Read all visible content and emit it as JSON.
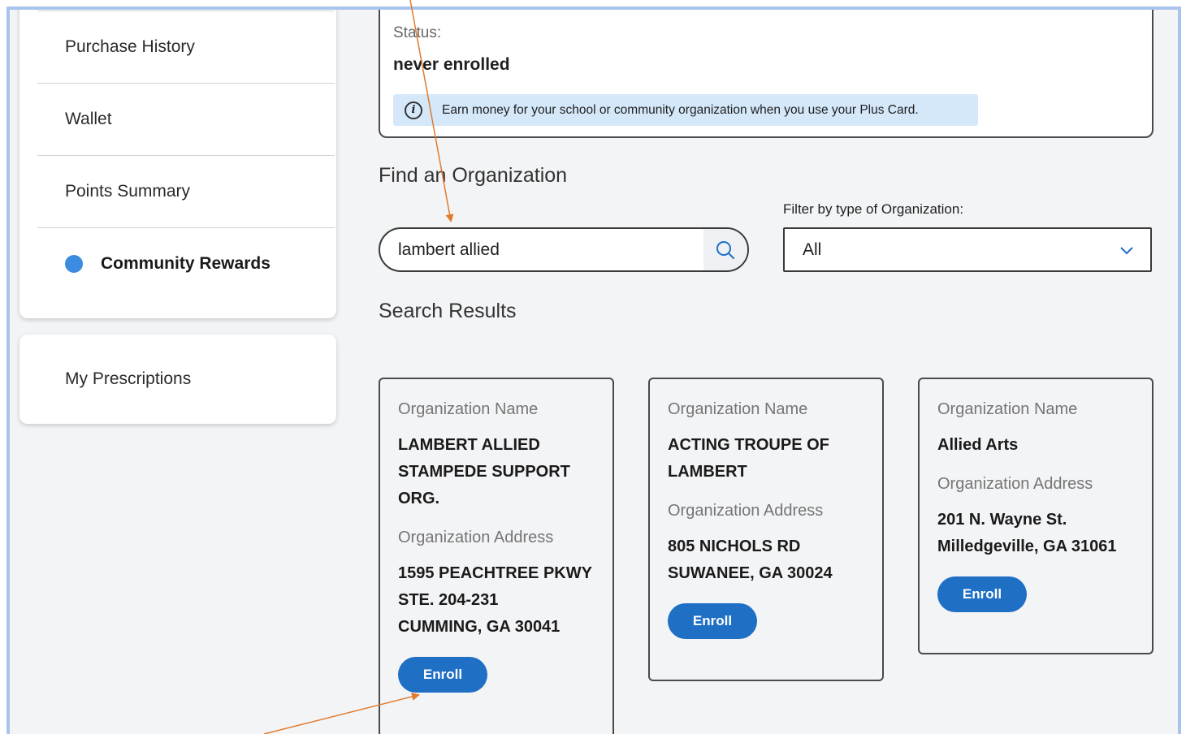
{
  "sidebar": {
    "items": [
      {
        "label": "Purchase History"
      },
      {
        "label": "Wallet"
      },
      {
        "label": "Points Summary"
      },
      {
        "label": "Community Rewards",
        "active": true
      }
    ],
    "secondary": {
      "label": "My Prescriptions"
    }
  },
  "status": {
    "label": "Status:",
    "value": "never enrolled",
    "info": "Earn money for your school or community organization when you use your Plus Card.",
    "info_icon": "info-icon"
  },
  "find": {
    "heading": "Find an Organization",
    "search_value": "lambert allied",
    "search_icon": "search-icon",
    "filter_label": "Filter by type of Organization:",
    "filter_value": "All",
    "filter_icon": "chevron-down-icon"
  },
  "results": {
    "heading": "Search Results",
    "name_label": "Organization Name",
    "address_label": "Organization Address",
    "enroll_label": "Enroll",
    "cards": [
      {
        "name_lines": [
          "LAMBERT ALLIED",
          "STAMPEDE SUPPORT",
          "ORG."
        ],
        "address_lines": [
          "1595 PEACHTREE PKWY",
          "STE. 204-231",
          "CUMMING, GA 30041"
        ]
      },
      {
        "name_lines": [
          "ACTING TROUPE OF",
          "LAMBERT"
        ],
        "address_lines": [
          "805 NICHOLS RD",
          "SUWANEE, GA 30024"
        ]
      },
      {
        "name_lines": [
          "Allied Arts"
        ],
        "address_lines": [
          "201 N. Wayne St.",
          "Milledgeville, GA 31061"
        ]
      }
    ]
  },
  "colors": {
    "accent": "#1f6fc5",
    "active_dot": "#3b8be0",
    "info_bg": "#d4e8fa",
    "annotation_arrow": "#e07b2e",
    "frame_border": "#a9c4ec"
  }
}
